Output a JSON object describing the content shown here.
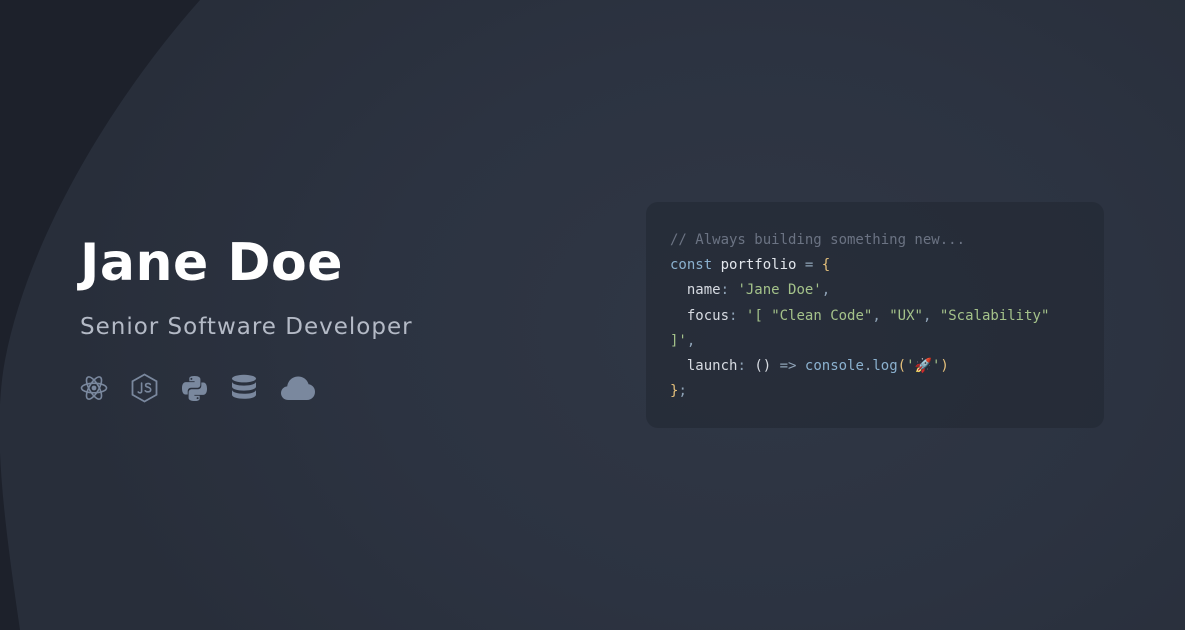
{
  "profile": {
    "name": "Jane Doe",
    "role": "Senior Software Developer"
  },
  "tech_icons": [
    {
      "icon": "react-icon"
    },
    {
      "icon": "nodejs-icon"
    },
    {
      "icon": "python-icon"
    },
    {
      "icon": "database-icon"
    },
    {
      "icon": "cloud-icon"
    }
  ],
  "code": {
    "comment": "// Always building something new...",
    "line2": {
      "keyword": "const",
      "ident": "portfolio",
      "eq": "=",
      "brace": "{"
    },
    "line3": {
      "prop": "name",
      "colon": ":",
      "value": "'Jane Doe'",
      "comma": ","
    },
    "line4": {
      "prop": "focus",
      "colon": ":",
      "open": "'[",
      "item1": "\"Clean Code\"",
      "sep1": ",",
      "item2": "\"UX\"",
      "sep2": ",",
      "item3": "\"Scalability\""
    },
    "line5": {
      "close": "]'",
      "comma": ","
    },
    "line6": {
      "prop": "launch",
      "colon": ":",
      "parens": "()",
      "arrow": "=>",
      "obj": "console",
      "dot": ".",
      "fn": "log",
      "open": "(",
      "q1": "'",
      "emoji": "🚀",
      "q2": "'",
      "close": ")"
    },
    "line7": {
      "brace": "}",
      "semi": ";"
    }
  },
  "colors": {
    "background": "#2b3240",
    "accent_curve": "#1d212b",
    "icon_color": "#7a889e",
    "name_color": "#ffffff",
    "role_color": "#b4bac6"
  }
}
